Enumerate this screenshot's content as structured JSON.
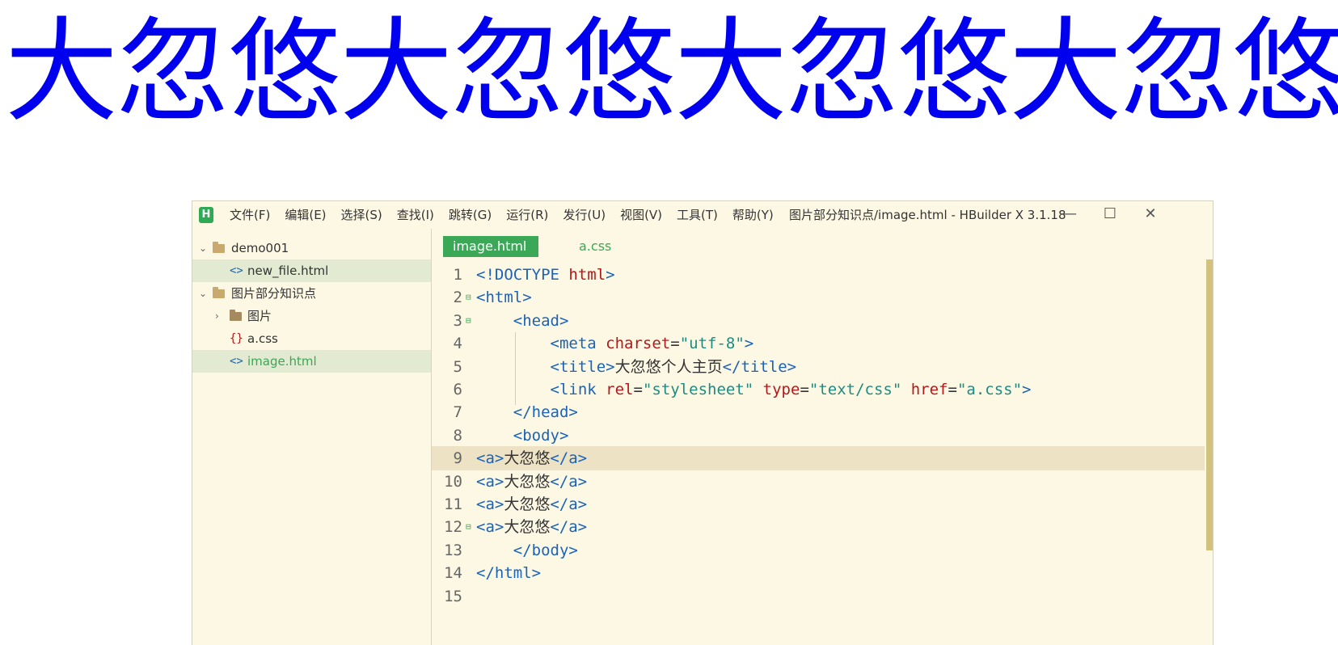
{
  "banner": {
    "text": "大忽悠大忽悠大忽悠大忽悠"
  },
  "titlebar": {
    "app_icon": "H",
    "menu": [
      "文件(F)",
      "编辑(E)",
      "选择(S)",
      "查找(I)",
      "跳转(G)",
      "运行(R)",
      "发行(U)",
      "视图(V)",
      "工具(T)",
      "帮助(Y)"
    ],
    "window_title": "图片部分知识点/image.html - HBuilder X 3.1.18",
    "controls": {
      "minimize": "—",
      "maximize": "☐",
      "close": "✕"
    }
  },
  "sidebar": {
    "items": [
      {
        "label": "demo001",
        "kind": "project"
      },
      {
        "label": "new_file.html",
        "kind": "html"
      },
      {
        "label": "图片部分知识点",
        "kind": "project"
      },
      {
        "label": "图片",
        "kind": "folder"
      },
      {
        "label": "a.css",
        "kind": "css"
      },
      {
        "label": "image.html",
        "kind": "html"
      }
    ]
  },
  "tabs": [
    {
      "label": "image.html",
      "active": true
    },
    {
      "label": "a.css",
      "active": false
    }
  ],
  "editor": {
    "line_numbers": [
      "1",
      "2",
      "3",
      "4",
      "5",
      "6",
      "7",
      "8",
      "9",
      "10",
      "11",
      "12",
      "13",
      "14",
      "15"
    ],
    "lines": [
      [
        {
          "c": "t",
          "v": "<!DOCTYPE "
        },
        {
          "c": "a",
          "v": "html"
        },
        {
          "c": "t",
          "v": ">"
        }
      ],
      [
        {
          "c": "t",
          "v": "<html>"
        }
      ],
      [
        {
          "c": "x",
          "v": "    "
        },
        {
          "c": "t",
          "v": "<head>"
        }
      ],
      [
        {
          "c": "x",
          "v": "        "
        },
        {
          "c": "t",
          "v": "<meta "
        },
        {
          "c": "a",
          "v": "charset"
        },
        {
          "c": "x",
          "v": "="
        },
        {
          "c": "s",
          "v": "\"utf-8\""
        },
        {
          "c": "t",
          "v": ">"
        }
      ],
      [
        {
          "c": "x",
          "v": "        "
        },
        {
          "c": "t",
          "v": "<title>"
        },
        {
          "c": "x",
          "v": "大忽悠个人主页"
        },
        {
          "c": "t",
          "v": "</title>"
        }
      ],
      [
        {
          "c": "x",
          "v": "        "
        },
        {
          "c": "t",
          "v": "<link "
        },
        {
          "c": "a",
          "v": "rel"
        },
        {
          "c": "x",
          "v": "="
        },
        {
          "c": "s",
          "v": "\"stylesheet\""
        },
        {
          "c": "x",
          "v": " "
        },
        {
          "c": "a",
          "v": "type"
        },
        {
          "c": "x",
          "v": "="
        },
        {
          "c": "s",
          "v": "\"text/css\""
        },
        {
          "c": "x",
          "v": " "
        },
        {
          "c": "a",
          "v": "href"
        },
        {
          "c": "x",
          "v": "="
        },
        {
          "c": "s",
          "v": "\"a.css\""
        },
        {
          "c": "t",
          "v": ">"
        }
      ],
      [
        {
          "c": "x",
          "v": "    "
        },
        {
          "c": "t",
          "v": "</head>"
        }
      ],
      [
        {
          "c": "x",
          "v": "    "
        },
        {
          "c": "t",
          "v": "<body>"
        }
      ],
      [
        {
          "c": "t",
          "v": "<a>"
        },
        {
          "c": "x",
          "v": "大忽悠"
        },
        {
          "c": "t",
          "v": "</a>"
        }
      ],
      [
        {
          "c": "t",
          "v": "<a>"
        },
        {
          "c": "x",
          "v": "大忽悠"
        },
        {
          "c": "t",
          "v": "</a>"
        }
      ],
      [
        {
          "c": "t",
          "v": "<a>"
        },
        {
          "c": "x",
          "v": "大忽悠"
        },
        {
          "c": "t",
          "v": "</a>"
        }
      ],
      [
        {
          "c": "t",
          "v": "<a>"
        },
        {
          "c": "x",
          "v": "大忽悠"
        },
        {
          "c": "t",
          "v": "</a>"
        }
      ],
      [
        {
          "c": "x",
          "v": "    "
        },
        {
          "c": "t",
          "v": "</body>"
        }
      ],
      [
        {
          "c": "t",
          "v": "</html>"
        }
      ],
      []
    ],
    "fold_markers": {
      "2": "⊟",
      "3": "⊟",
      "12": "⊟"
    },
    "current_line": 9
  },
  "colors": {
    "tag": "#1a63b8",
    "attribute": "#b3191c",
    "string": "#1f8a82",
    "accent": "#3aa856",
    "banner": "#0000ee"
  }
}
